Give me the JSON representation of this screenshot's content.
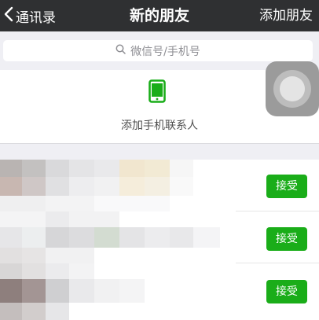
{
  "navbar": {
    "back_label": "通讯录",
    "title": "新的朋友",
    "action_label": "添加朋友"
  },
  "search": {
    "placeholder": "微信号/手机号"
  },
  "add_phone_contacts": {
    "label": "添加手机联系人",
    "icon": "mobile-phone-icon",
    "icon_color": "#1aad19"
  },
  "requests": [
    {
      "accept_label": "接受"
    },
    {
      "accept_label": "接受"
    },
    {
      "accept_label": "接受"
    }
  ],
  "colors": {
    "navbar_bg": "#2f3032",
    "accent_green": "#1aad19",
    "page_bg": "#efeff4"
  }
}
